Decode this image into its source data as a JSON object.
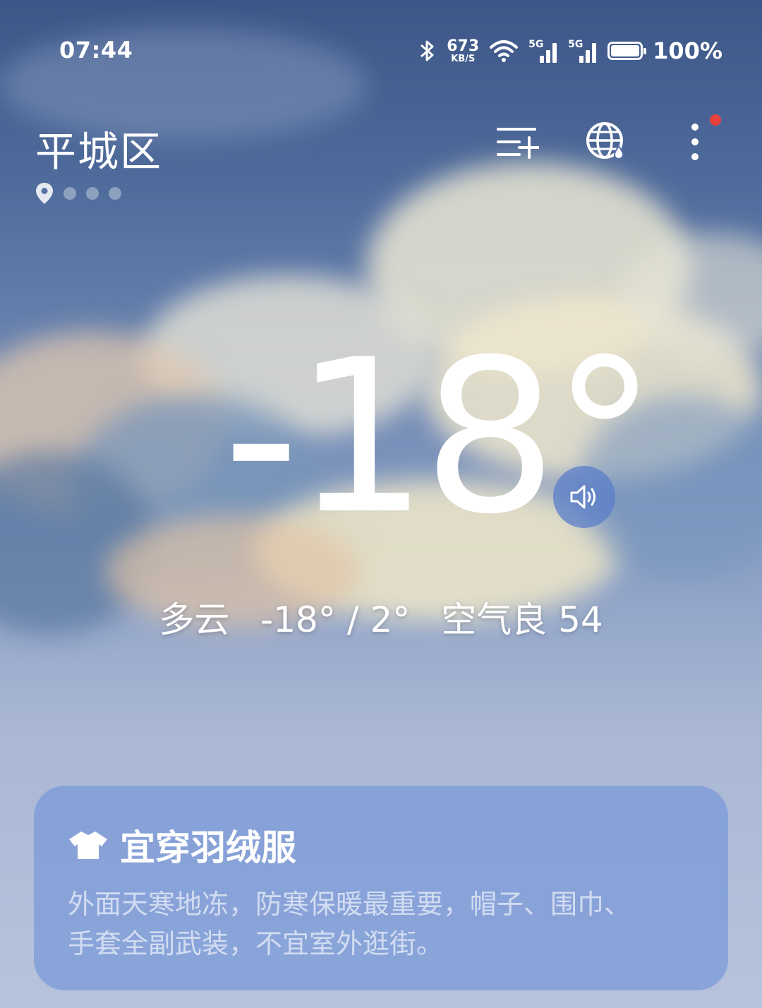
{
  "status_bar": {
    "time": "07:44",
    "net_speed_value": "673",
    "net_speed_unit": "KB/S",
    "sim1_label": "5G",
    "sim2_label": "5G",
    "battery_percent": "100%",
    "battery_level": 1.0
  },
  "header": {
    "city": "平城区",
    "page_count": 4,
    "current_page": 0
  },
  "weather": {
    "temperature": "-18°",
    "condition": "多云",
    "range": "-18° / 2°",
    "air_quality": "空气良 54"
  },
  "card": {
    "title": "宜穿羽绒服",
    "description_line1": "外面天寒地冻，防寒保暖最重要，帽子、围巾、",
    "description_line2": "手套全副武装，不宜室外逛街。"
  },
  "colors": {
    "accent_red": "#e8413b",
    "card_bg": "#7898d8",
    "speaker_bg": "#5a7ec8"
  }
}
